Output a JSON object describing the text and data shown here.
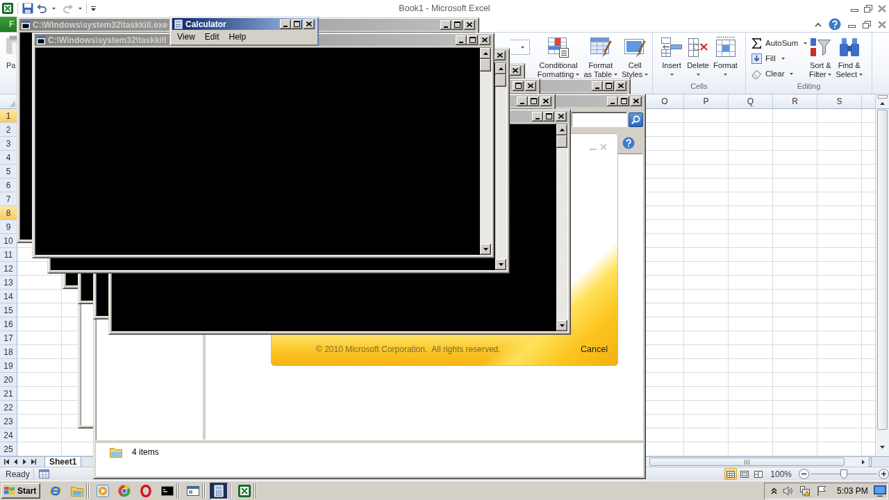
{
  "excel": {
    "title": "Book1 - Microsoft Excel",
    "file_tab": "F",
    "paste_label": "Pa",
    "styles_buttons": [
      {
        "kind": "conditional_formatting",
        "label": "Conditional\nFormatting"
      },
      {
        "kind": "format_as_table",
        "label": "Format\nas Table"
      },
      {
        "kind": "cell_styles",
        "label": "Cell\nStyles"
      }
    ],
    "cells_group": {
      "label": "Cells",
      "buttons": [
        {
          "kind": "insert",
          "label": "Insert"
        },
        {
          "kind": "delete",
          "label": "Delete"
        },
        {
          "kind": "format",
          "label": "Format"
        }
      ]
    },
    "editing_group": {
      "label": "Editing",
      "small_buttons": [
        {
          "kind": "autosum",
          "label": "AutoSum"
        },
        {
          "kind": "fill",
          "label": "Fill"
        },
        {
          "kind": "clear",
          "label": "Clear"
        }
      ],
      "buttons": [
        {
          "kind": "sort_filter",
          "label": "Sort &\nFilter"
        },
        {
          "kind": "find_select",
          "label": "Find &\nSelect"
        }
      ]
    },
    "columns": [
      "O",
      "P",
      "Q",
      "R",
      "S"
    ],
    "rows": [
      {
        "label": "1",
        "selected": true
      },
      {
        "label": "2",
        "selected": false
      },
      {
        "label": "3",
        "selected": false
      },
      {
        "label": "4",
        "selected": false
      },
      {
        "label": "5",
        "selected": false
      },
      {
        "label": "6",
        "selected": false
      },
      {
        "label": "7",
        "selected": false
      },
      {
        "label": "8",
        "selected": true
      },
      {
        "label": "9",
        "selected": false
      },
      {
        "label": "10",
        "selected": false
      },
      {
        "label": "11",
        "selected": false
      },
      {
        "label": "12",
        "selected": false
      },
      {
        "label": "13",
        "selected": false
      },
      {
        "label": "14",
        "selected": false
      },
      {
        "label": "15",
        "selected": false
      },
      {
        "label": "16",
        "selected": false
      },
      {
        "label": "17",
        "selected": false
      },
      {
        "label": "18",
        "selected": false
      },
      {
        "label": "19",
        "selected": false
      },
      {
        "label": "20",
        "selected": false
      },
      {
        "label": "21",
        "selected": false
      },
      {
        "label": "22",
        "selected": false
      },
      {
        "label": "23",
        "selected": false
      },
      {
        "label": "24",
        "selected": false
      },
      {
        "label": "25",
        "selected": false
      }
    ],
    "sheet_tab": "Sheet1",
    "status": "Ready",
    "view_buttons": [
      {
        "kind": "normal",
        "selected": true
      },
      {
        "kind": "page_layout",
        "selected": false
      },
      {
        "kind": "page_break_preview",
        "selected": false
      }
    ],
    "zoom": {
      "reading": "100%",
      "level": 0.5
    }
  },
  "console_windows": [
    {
      "title": "C:\\Windows\\system32\\taskkill.exe"
    },
    {
      "title": "C:\\Windows\\system32\\taskkill"
    }
  ],
  "calculator": {
    "title": "Calculator",
    "menu": [
      "View",
      "Edit",
      "Help"
    ]
  },
  "explorer": {
    "status": "4 items"
  },
  "splash": {
    "copyright": "© 2010 Microsoft Corporation.  All rights reserved.",
    "cancel": "Cancel"
  },
  "taskbar": {
    "start": "Start",
    "buttons": [
      {
        "kind": "browser",
        "selected": false
      },
      {
        "kind": "folder",
        "selected": false
      },
      {
        "kind": "media",
        "selected": false
      },
      {
        "kind": "ring_browser",
        "selected": false
      },
      {
        "kind": "oval_browser",
        "selected": false
      },
      {
        "kind": "console",
        "selected": false
      },
      {
        "kind": "window",
        "selected": false
      },
      {
        "kind": "calculator",
        "selected": true
      },
      {
        "kind": "spreadsheet",
        "selected": false
      }
    ],
    "clock": "5:03 PM"
  }
}
